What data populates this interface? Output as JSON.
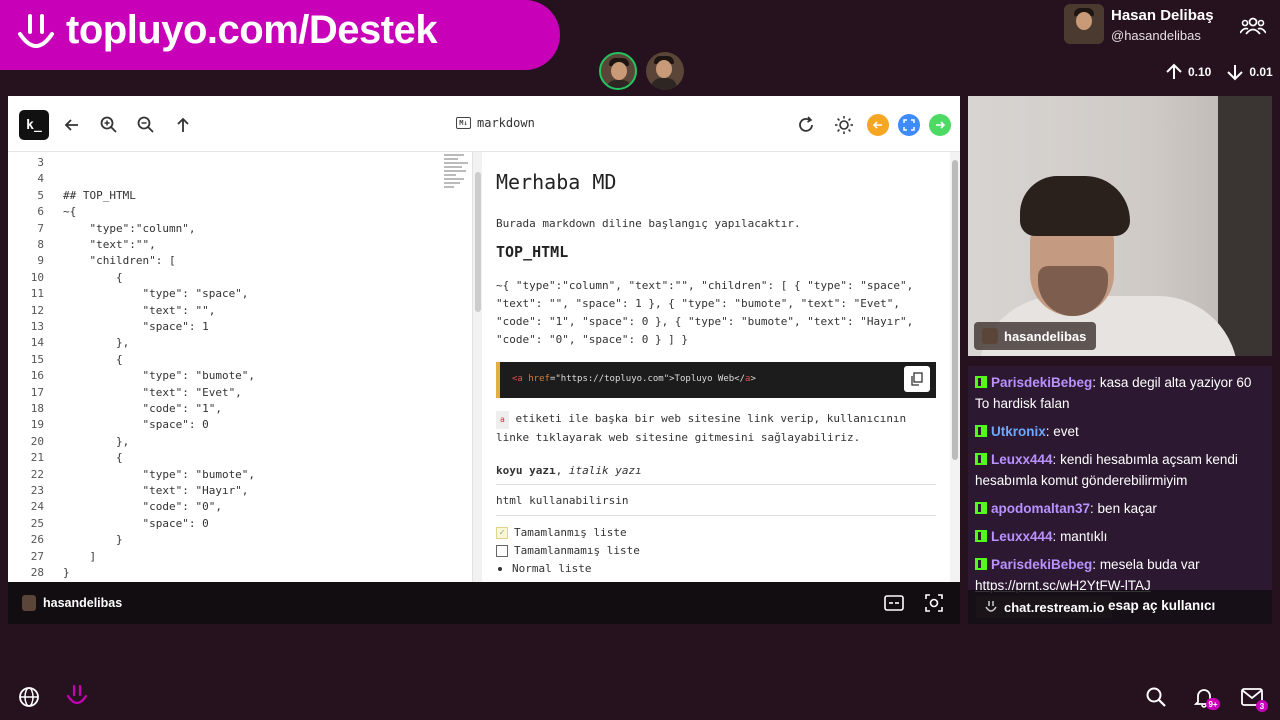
{
  "banner": {
    "text": "topluyo.com/Destek"
  },
  "user": {
    "name": "Hasan Delibaş",
    "handle": "@hasandelibas"
  },
  "stats": {
    "up": "0.10",
    "down": "0.01"
  },
  "browser": {
    "title": "markdown",
    "logo": "k_",
    "colors": {
      "orange": "#f5a623",
      "blue": "#3d8bfd",
      "green": "#4cd964"
    }
  },
  "editor": {
    "lines": [
      {
        "n": "3",
        "code": ""
      },
      {
        "n": "4",
        "code": ""
      },
      {
        "n": "5",
        "code": "## TOP_HTML"
      },
      {
        "n": "6",
        "code": "~{"
      },
      {
        "n": "7",
        "code": "    \"type\":\"column\","
      },
      {
        "n": "8",
        "code": "    \"text\":\"\","
      },
      {
        "n": "9",
        "code": "    \"children\": ["
      },
      {
        "n": "10",
        "code": "        {"
      },
      {
        "n": "11",
        "code": "            \"type\": \"space\","
      },
      {
        "n": "12",
        "code": "            \"text\": \"\","
      },
      {
        "n": "13",
        "code": "            \"space\": 1"
      },
      {
        "n": "14",
        "code": "        },"
      },
      {
        "n": "15",
        "code": "        {"
      },
      {
        "n": "16",
        "code": "            \"type\": \"bumote\","
      },
      {
        "n": "17",
        "code": "            \"text\": \"Evet\","
      },
      {
        "n": "18",
        "code": "            \"code\": \"1\","
      },
      {
        "n": "19",
        "code": "            \"space\": 0"
      },
      {
        "n": "20",
        "code": "        },"
      },
      {
        "n": "21",
        "code": "        {"
      },
      {
        "n": "22",
        "code": "            \"type\": \"bumote\","
      },
      {
        "n": "23",
        "code": "            \"text\": \"Hayır\","
      },
      {
        "n": "24",
        "code": "            \"code\": \"0\","
      },
      {
        "n": "25",
        "code": "            \"space\": 0"
      },
      {
        "n": "26",
        "code": "        }"
      },
      {
        "n": "27",
        "code": "    ]"
      },
      {
        "n": "28",
        "code": "}"
      }
    ]
  },
  "preview": {
    "h1": "Merhaba MD",
    "p1": "Burada markdown diline başlangıç yapılacaktır.",
    "h2": "TOP_HTML",
    "json": "~{ \"type\":\"column\", \"text\":\"\", \"children\": [ { \"type\": \"space\", \"text\": \"\", \"space\": 1 }, { \"type\": \"bumote\", \"text\": \"Evet\", \"code\": \"1\", \"space\": 0 }, { \"type\": \"bumote\", \"text\": \"Hayır\", \"code\": \"0\", \"space\": 0 } ] }",
    "codeblock": {
      "tag_open": "<a",
      "attr": " href",
      "val": "=\"https://topluyo.com\">Topluyo Web</",
      "tag_close": "a",
      "end": ">"
    },
    "inline_code": "a",
    "p2": " etiketi ile başka bir web sitesine link verip, kullanıcının linke tıklayarak web sitesine gitmesini sağlayabiliriz.",
    "bold": "koyu yazı",
    "italic": "italik yazı",
    "p4": "html kullanabilirsin",
    "list": [
      {
        "label": "Tamamlanmış liste",
        "kind": "checked"
      },
      {
        "label": "Tamamlanmamış liste",
        "kind": "unchecked"
      },
      {
        "label": "Normal liste",
        "kind": "bullet"
      }
    ]
  },
  "bottombar": {
    "name": "hasandelibas"
  },
  "camera": {
    "tag": "hasandelibas"
  },
  "chat": {
    "messages": [
      {
        "user": "ParisdekiBebeg",
        "text": "kasa degil alta yaziyor 60 To hardisk falan",
        "color": "#b992ff"
      },
      {
        "user": "Utkronix",
        "text": "evet",
        "color": "#6fa8ff"
      },
      {
        "user": "Leuxx444",
        "text": "kendi hesabımla açsam kendi hesabımla komut gönderebilirmiyim",
        "color": "#b992ff"
      },
      {
        "user": "apodomaltan37",
        "text": "ben kaçar",
        "color": "#b992ff"
      },
      {
        "user": "Leuxx444",
        "text": "mantıklı",
        "color": "#b992ff"
      },
      {
        "user": "ParisdekiBebeg",
        "text": "mesela buda var",
        "color": "#b992ff"
      }
    ],
    "link": "https://prnt.sc/wH2YtFW-lTAJ",
    "source": "chat.restream.io",
    "tail": "esap aç kullanıcı"
  },
  "badges": {
    "notifications": "9+",
    "messages": "3"
  },
  "icons": [
    "smile-logo-icon",
    "group-icon",
    "arrow-up-icon",
    "arrow-down-icon",
    "back-arrow-icon",
    "zoom-in-icon",
    "zoom-out-icon",
    "up-arrow-icon",
    "refresh-icon",
    "sun-icon",
    "copy-icon",
    "subtitles-icon",
    "screenshot-icon",
    "globe-icon",
    "search-icon",
    "bell-icon",
    "mail-icon"
  ]
}
